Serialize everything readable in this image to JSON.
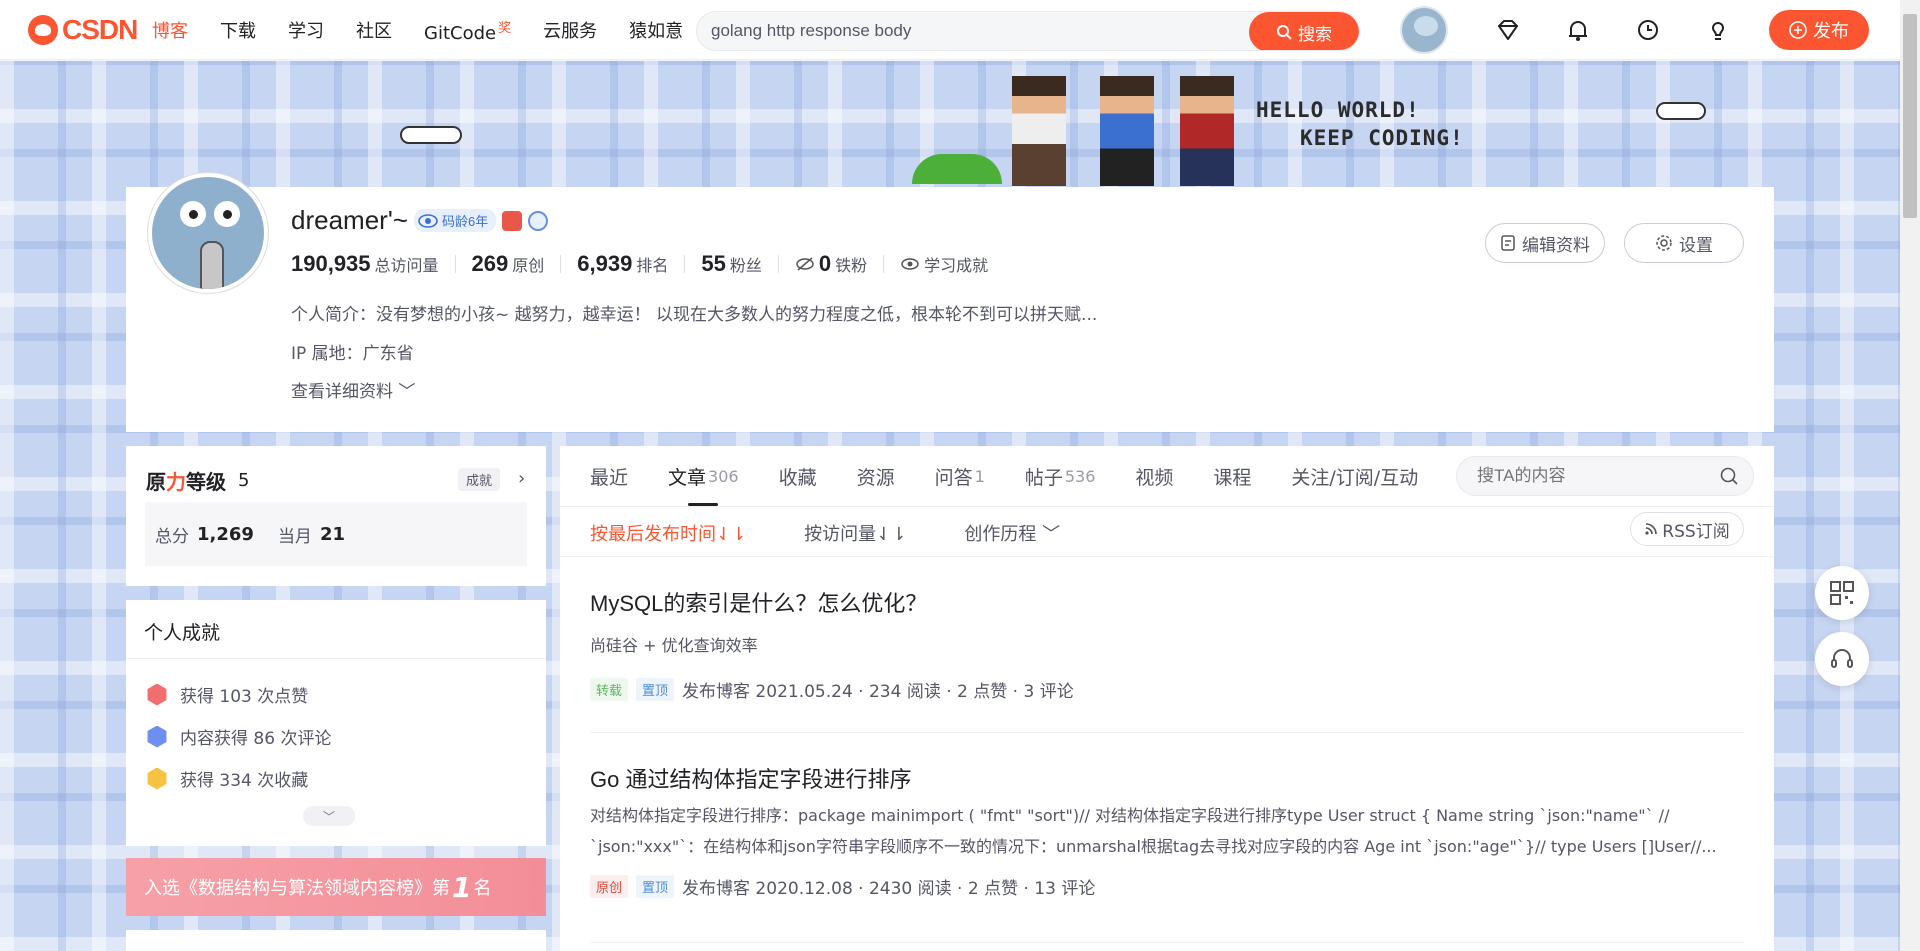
{
  "header": {
    "logo": "CSDN",
    "nav": [
      {
        "label": "博客",
        "active": true
      },
      {
        "label": "下载"
      },
      {
        "label": "学习"
      },
      {
        "label": "社区"
      },
      {
        "label": "GitCode",
        "badge": "奖"
      },
      {
        "label": "云服务"
      },
      {
        "label": "猿如意"
      }
    ],
    "search_value": "golang http response body",
    "search_button": "搜索",
    "publish_button": "发布"
  },
  "banner": {
    "line1": "HELLO WORLD!",
    "line2": "KEEP CODING!"
  },
  "profile": {
    "name": "dreamer'~",
    "code_age": "码龄6年",
    "stats": [
      {
        "value": "190,935",
        "label": "总访问量"
      },
      {
        "value": "269",
        "label": "原创"
      },
      {
        "value": "6,939",
        "label": "排名"
      },
      {
        "value": "55",
        "label": "粉丝"
      },
      {
        "value": "0",
        "label": "铁粉"
      }
    ],
    "learning": "学习成就",
    "bio": "个人简介：没有梦想的小孩~ 越努力，越幸运！ 以现在大多数人的努力程度之低，根本轮不到可以拼天赋...",
    "ip": "IP 属地：广东省",
    "more": "查看详细资料",
    "edit_button": "编辑资料",
    "settings_button": "设置"
  },
  "level": {
    "title_a": "原",
    "title_b": "力",
    "title_c": "等级",
    "level": "5",
    "achievement_tag": "成就",
    "total_label": "总分",
    "total_value": "1,269",
    "month_label": "当月",
    "month_value": "21"
  },
  "achievements": {
    "title": "个人成就",
    "items": [
      {
        "text": "获得 103 次点赞",
        "color": "#f26d6d"
      },
      {
        "text": "内容获得 86 次评论",
        "color": "#6f8ff0"
      },
      {
        "text": "获得 334 次收藏",
        "color": "#f5c242"
      }
    ]
  },
  "rank_banner": {
    "text": "入选《数据结构与算法领域内容榜》第",
    "num": "1",
    "suffix": "名"
  },
  "tabs": [
    {
      "label": "最近"
    },
    {
      "label": "文章",
      "count": "306",
      "active": true
    },
    {
      "label": "收藏"
    },
    {
      "label": "资源"
    },
    {
      "label": "问答",
      "count": "1"
    },
    {
      "label": "帖子",
      "count": "536"
    },
    {
      "label": "视频"
    },
    {
      "label": "课程"
    },
    {
      "label": "关注/订阅/互动"
    }
  ],
  "tab_search_placeholder": "搜TA的内容",
  "sort": {
    "by_time": "按最后发布时间⇃⇂",
    "by_views": "按访问量⇃⇂",
    "history": "创作历程",
    "rss": "RSS订阅"
  },
  "articles": [
    {
      "title": "MySQL的索引是什么？怎么优化？",
      "desc": "尚硅谷 + 优化查询效率",
      "tags": [
        {
          "text": "转载",
          "style": "green"
        },
        {
          "text": "置顶",
          "style": "blue"
        }
      ],
      "meta": "发布博客 2021.05.24 ·  234 阅读 ·  2 点赞 ·  3 评论"
    },
    {
      "title": "Go 通过结构体指定字段进行排序",
      "desc": "对结构体指定字段进行排序：package mainimport ( \"fmt\" \"sort\")// 对结构体指定字段进行排序type User struct { Name string `json:\"name\"` // `json:\"xxx\"`：在结构体和json字符串字段顺序不一致的情况下：unmarshal根据tag去寻找对应字段的内容 Age int `json:\"age\"`}// type Users []User//...",
      "tags": [
        {
          "text": "原创",
          "style": "red"
        },
        {
          "text": "置顶",
          "style": "blue"
        }
      ],
      "meta": "发布博客 2020.12.08 ·  2430 阅读 ·  2 点赞 ·  13 评论"
    }
  ],
  "colors": {
    "accent": "#fc5531",
    "plaid": "#c6d5f2"
  }
}
